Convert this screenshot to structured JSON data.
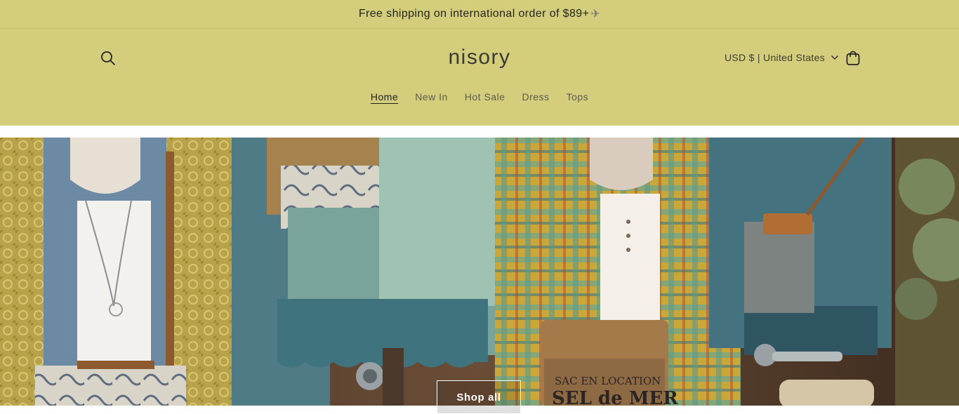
{
  "announcement": {
    "text": "Free shipping on international order of $89+",
    "icon": "airplane-icon"
  },
  "header": {
    "logo": "nisory",
    "currency_label": "USD $ | United States",
    "icons": {
      "search": "search-icon",
      "cart": "cart-icon",
      "currency_dropdown": "chevron-down-icon"
    }
  },
  "nav": {
    "items": [
      {
        "label": "Home",
        "active": true
      },
      {
        "label": "New In",
        "active": false
      },
      {
        "label": "Hot Sale",
        "active": false
      },
      {
        "label": "Dress",
        "active": false
      },
      {
        "label": "Tops",
        "active": false
      }
    ]
  },
  "hero": {
    "button_label": "Shop all",
    "bag_text_line1": "SAC EN LOCATION",
    "bag_text_line2": "SEL de MER"
  },
  "colors": {
    "header_bg": "#d4ce7c",
    "text": "#23231f"
  }
}
